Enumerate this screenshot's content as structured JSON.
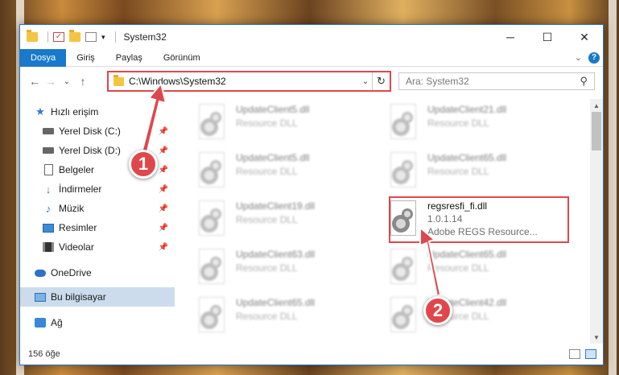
{
  "window": {
    "title": "System32",
    "minimize": "─",
    "maximize": "☐",
    "close": "✕"
  },
  "ribbon": {
    "tabs": [
      "Dosya",
      "Giriş",
      "Paylaş",
      "Görünüm"
    ],
    "expand": "⌄",
    "help": "?"
  },
  "nav": {
    "back": "←",
    "forward": "→",
    "recent": "⌄",
    "up": "↑"
  },
  "address": {
    "path": "C:\\Windows\\System32",
    "dropdown": "⌄",
    "refresh": "↻"
  },
  "search": {
    "placeholder": "Ara: System32",
    "icon": "⚲"
  },
  "sidebar": {
    "items": [
      {
        "label": "Hızlı erişim",
        "icon": "star-icon"
      },
      {
        "label": "Yerel Disk (C:)",
        "icon": "disk-icon",
        "pinned": true
      },
      {
        "label": "Yerel Disk (D:)",
        "icon": "disk-icon",
        "pinned": true
      },
      {
        "label": "Belgeler",
        "icon": "document-icon",
        "pinned": true
      },
      {
        "label": "İndirmeler",
        "icon": "download-icon",
        "pinned": true
      },
      {
        "label": "Müzik",
        "icon": "music-icon",
        "pinned": true
      },
      {
        "label": "Resimler",
        "icon": "pictures-icon",
        "pinned": true
      },
      {
        "label": "Videolar",
        "icon": "videos-icon",
        "pinned": true
      },
      {
        "label": "OneDrive",
        "icon": "cloud-icon"
      },
      {
        "label": "Bu bilgisayar",
        "icon": "computer-icon",
        "selected": true
      },
      {
        "label": "Ağ",
        "icon": "network-icon"
      }
    ],
    "pin_glyph": "📌",
    "star_glyph": "★",
    "download_glyph": "↓",
    "music_glyph": "♪"
  },
  "files": [
    {
      "name": "UpdateClient5.dll",
      "type": "Resource DLL"
    },
    {
      "name": "UpdateClient21.dll",
      "type": "Resource DLL"
    },
    {
      "name": "UpdateClient5.dll",
      "type": "Resource DLL"
    },
    {
      "name": "UpdateClient65.dll",
      "type": "Resource DLL"
    },
    {
      "name": "UpdateClient19.dll",
      "type": "Resource DLL"
    },
    {
      "name": "regsresfi_fi.dll",
      "version": "1.0.1.14",
      "type": "Adobe REGS Resource..."
    },
    {
      "name": "UpdateClient63.dll",
      "type": "Resource DLL"
    },
    {
      "name": "UpdateClient65.dll",
      "type": "Resource DLL"
    },
    {
      "name": "UpdateClient65.dll",
      "type": "Resource DLL"
    },
    {
      "name": "UpdateClient42.dll",
      "type": "Resource DLL"
    }
  ],
  "status": {
    "count": "156 öğe"
  },
  "callouts": {
    "one": "1",
    "two": "2"
  },
  "colors": {
    "accent": "#1979ca",
    "callout": "#e0474c"
  }
}
